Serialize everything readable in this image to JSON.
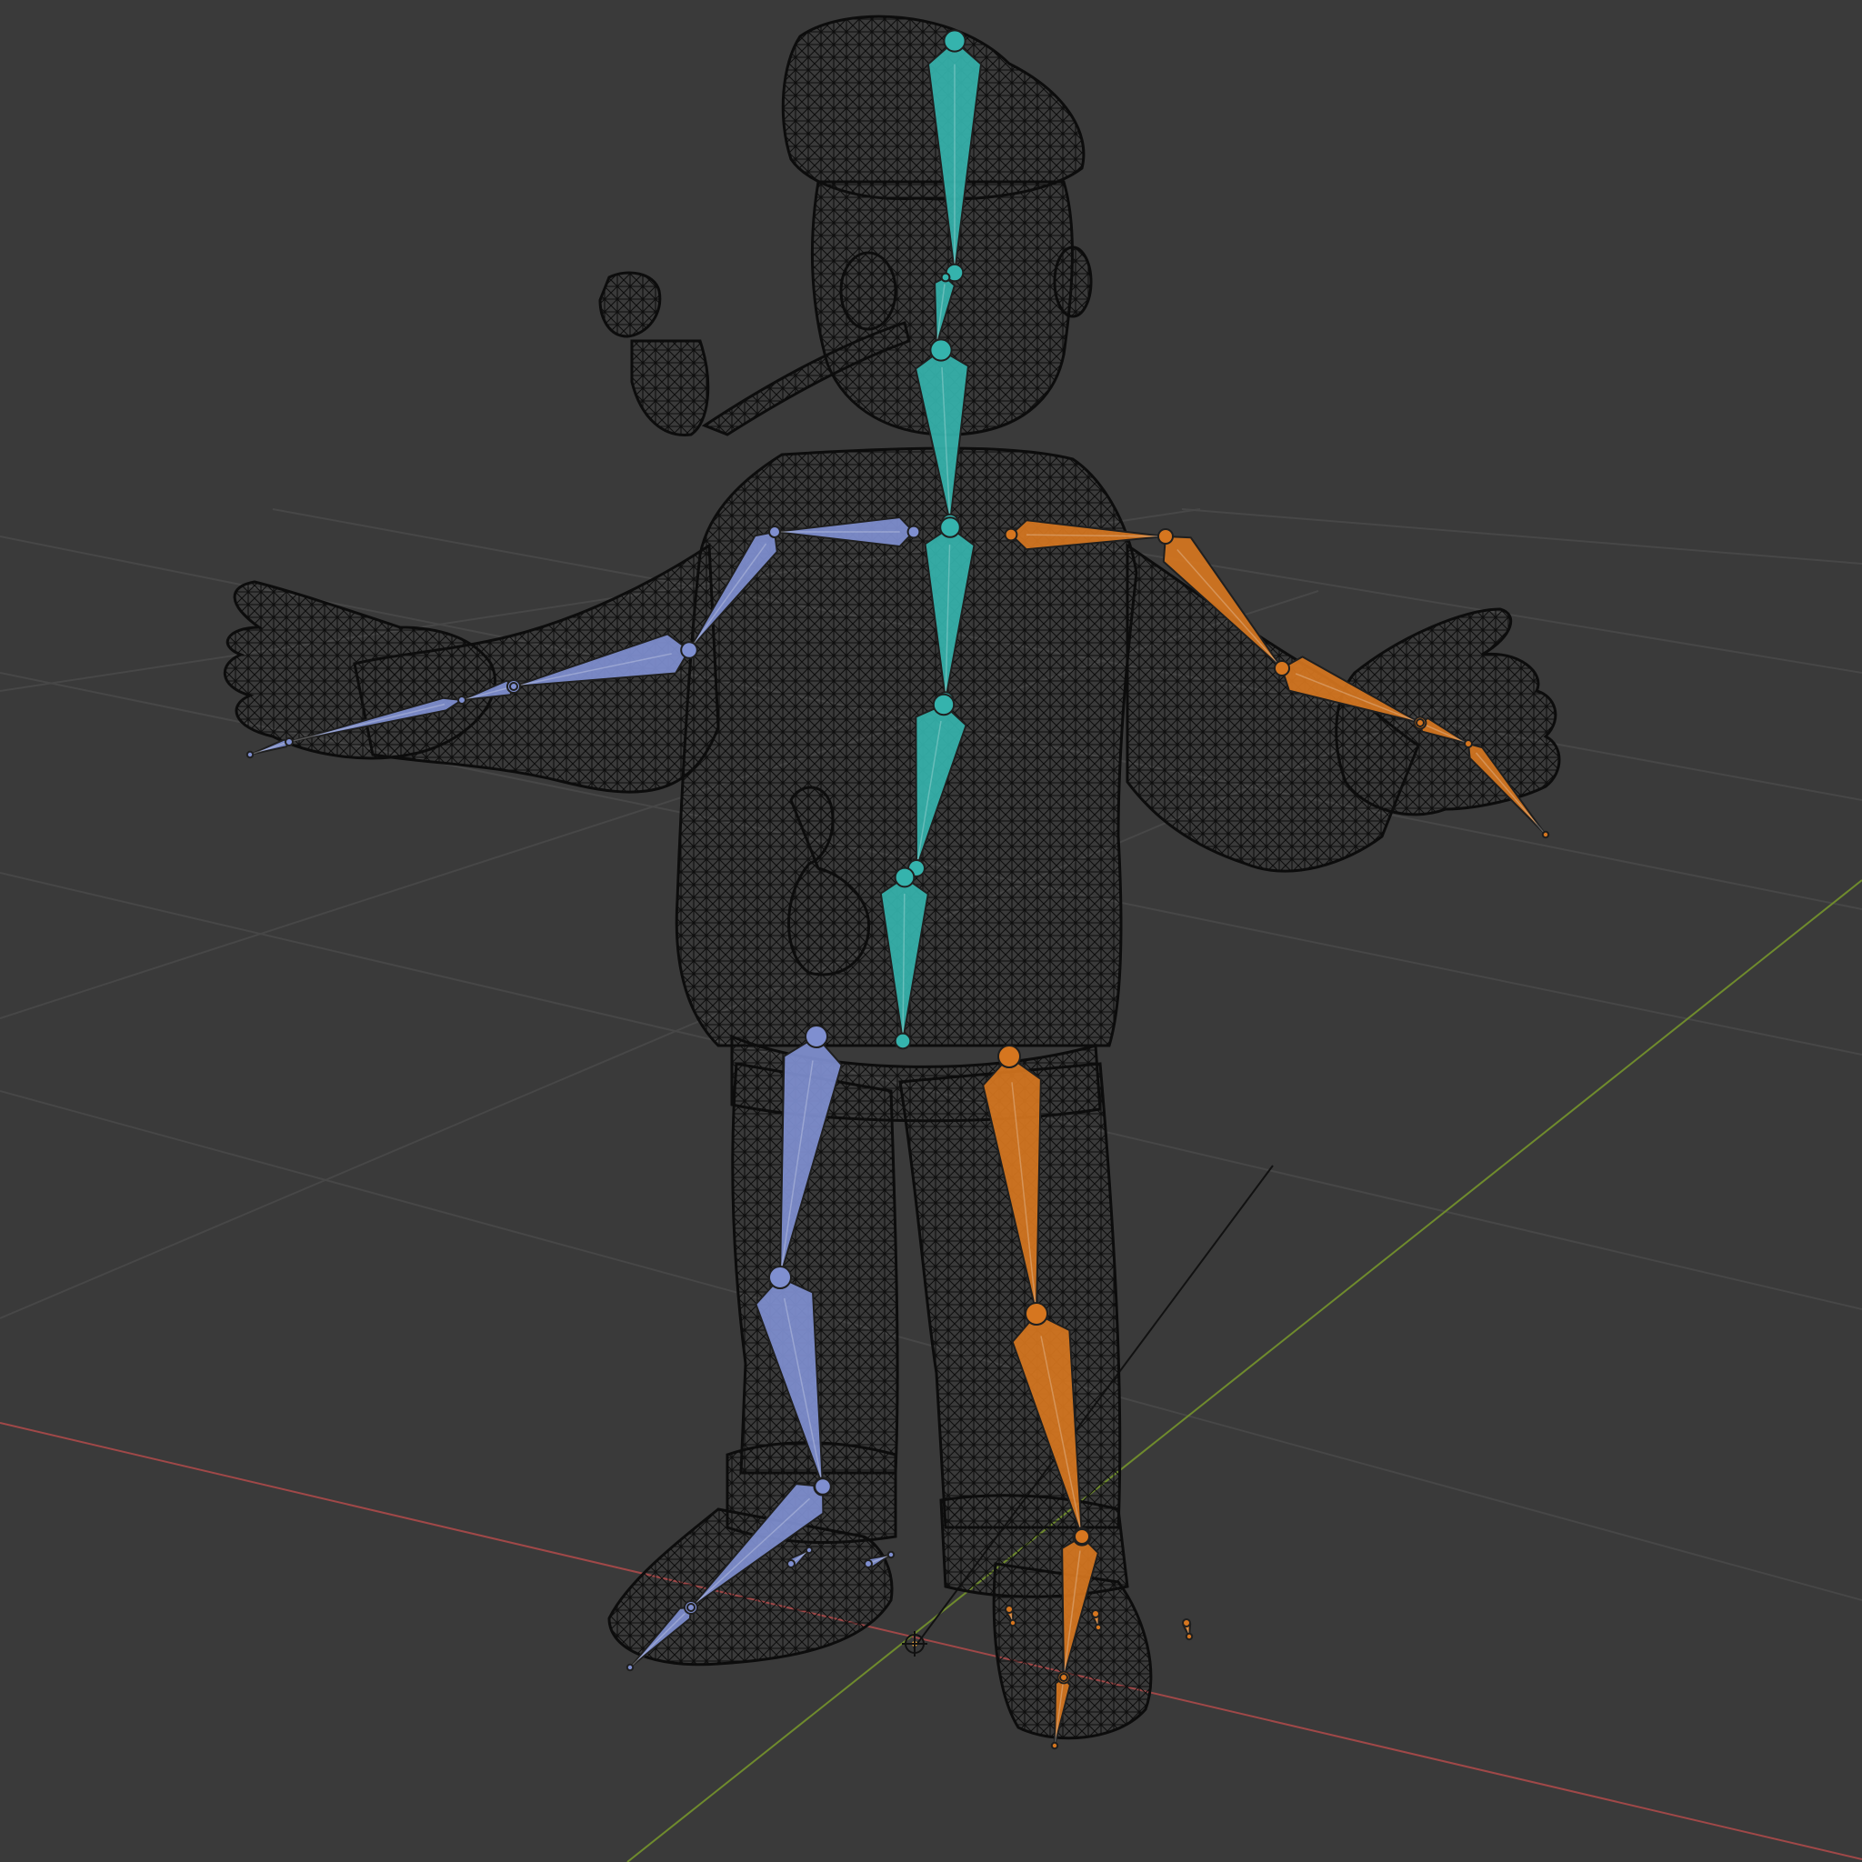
{
  "viewport": {
    "background": "#3a3a3a",
    "grid_color": "#474747",
    "x_axis_color": "#a04848",
    "y_axis_color": "#6f8b2d",
    "wire_color": "#0c0c0c"
  },
  "armature": {
    "center_color": "#35b3ad",
    "left_color": "#7f8fd0",
    "right_color": "#d6761f"
  },
  "icons": {
    "origin": "origin-cursor-icon"
  }
}
